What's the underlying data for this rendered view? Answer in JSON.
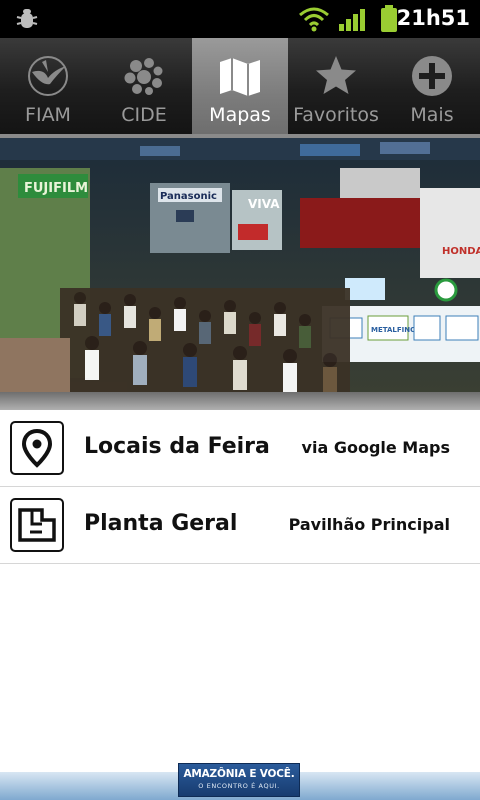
{
  "status_bar": {
    "time": "21h51",
    "icons": [
      "debug-bug-icon",
      "wifi-icon",
      "signal-icon",
      "battery-icon"
    ],
    "accent_color": "#9acd32"
  },
  "tabs": [
    {
      "label": "FIAM",
      "icon": "bird-icon",
      "active": false
    },
    {
      "label": "CIDE",
      "icon": "dots-cluster-icon",
      "active": false
    },
    {
      "label": "Mapas",
      "icon": "map-icon",
      "active": true
    },
    {
      "label": "Favoritos",
      "icon": "star-icon",
      "active": false
    },
    {
      "label": "Mais",
      "icon": "plus-circle-icon",
      "active": false
    }
  ],
  "banner": {
    "description": "photo",
    "sign_texts": [
      "Panasonic",
      "HONDA",
      "METALFINO",
      "VIVA"
    ]
  },
  "list": [
    {
      "title": "Locais da Feira",
      "subtitle": "via Google Maps",
      "icon": "map-pin-icon"
    },
    {
      "title": "Planta Geral",
      "subtitle": "Pavilhão Principal",
      "icon": "floor-plan-icon"
    }
  ],
  "footer": {
    "logo_line1": "AMAZÔNIA E VOCÊ.",
    "logo_line2": "O ENCONTRO É AQUI."
  }
}
